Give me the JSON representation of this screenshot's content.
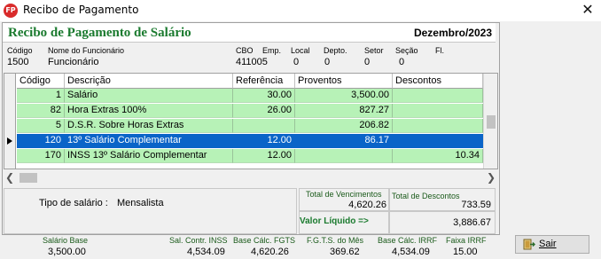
{
  "window": {
    "app_icon_text": "FP",
    "title": "Recibo de Pagamento",
    "close_symbol": "✕"
  },
  "header": {
    "title": "Recibo de Pagamento de Salário",
    "period": "Dezembro/2023"
  },
  "employee": {
    "codigo_label": "Código",
    "codigo": "1500",
    "nome_label": "Nome do Funcionário",
    "nome": "Funcionário",
    "cbo_label": "CBO",
    "cbo": "411005",
    "emp_label": "Emp.",
    "local_label": "Local",
    "local": "0",
    "depto_label": "Depto.",
    "depto": "0",
    "setor_label": "Setor",
    "setor": "0",
    "secao_label": "Seção",
    "secao": "0",
    "fl_label": "Fl."
  },
  "grid": {
    "columns": [
      "Código",
      "Descrição",
      "Referência",
      "Proventos",
      "Descontos"
    ],
    "rows": [
      {
        "codigo": "1",
        "descricao": "Salário",
        "referencia": "30.00",
        "proventos": "3,500.00",
        "descontos": ""
      },
      {
        "codigo": "82",
        "descricao": "Hora Extras 100%",
        "referencia": "26.00",
        "proventos": "827.27",
        "descontos": ""
      },
      {
        "codigo": "5",
        "descricao": "D.S.R. Sobre Horas Extras",
        "referencia": "",
        "proventos": "206.82",
        "descontos": ""
      },
      {
        "codigo": "120",
        "descricao": "13º Salário Complementar",
        "referencia": "12.00",
        "proventos": "86.17",
        "descontos": ""
      },
      {
        "codigo": "170",
        "descricao": "INSS 13º Salário Complementar",
        "referencia": "12.00",
        "proventos": "",
        "descontos": "10.34"
      }
    ],
    "selected_row": 3
  },
  "summary": {
    "tipo_label": "Tipo de salário :",
    "tipo_value": "Mensalista",
    "total_venc_label": "Total de Vencimentos",
    "total_venc": "4,620.26",
    "total_desc_label": "Total de Descontos",
    "total_desc": "733.59",
    "liquido_label": "Valor Líquido  =>",
    "liquido": "3,886.67"
  },
  "footer": {
    "salario_base_label": "Salário Base",
    "salario_base": "3,500.00",
    "sal_contr_label": "Sal. Contr. INSS",
    "sal_contr": "4,534.09",
    "base_fgts_label": "Base Cálc. FGTS",
    "base_fgts": "4,620.26",
    "fgts_mes_label": "F.G.T.S. do Mês",
    "fgts_mes": "369.62",
    "base_irrf_label": "Base Cálc. IRRF",
    "base_irrf": "4,534.09",
    "faixa_irrf_label": "Faixa IRRF",
    "faixa_irrf": "15.00"
  },
  "actions": {
    "exit_label": "Sair",
    "exit_icon": "exit-door-icon"
  },
  "colors": {
    "title_green": "#1a7a2e",
    "row_green": "#b7f2b7",
    "row_selected": "#0a64c8"
  }
}
